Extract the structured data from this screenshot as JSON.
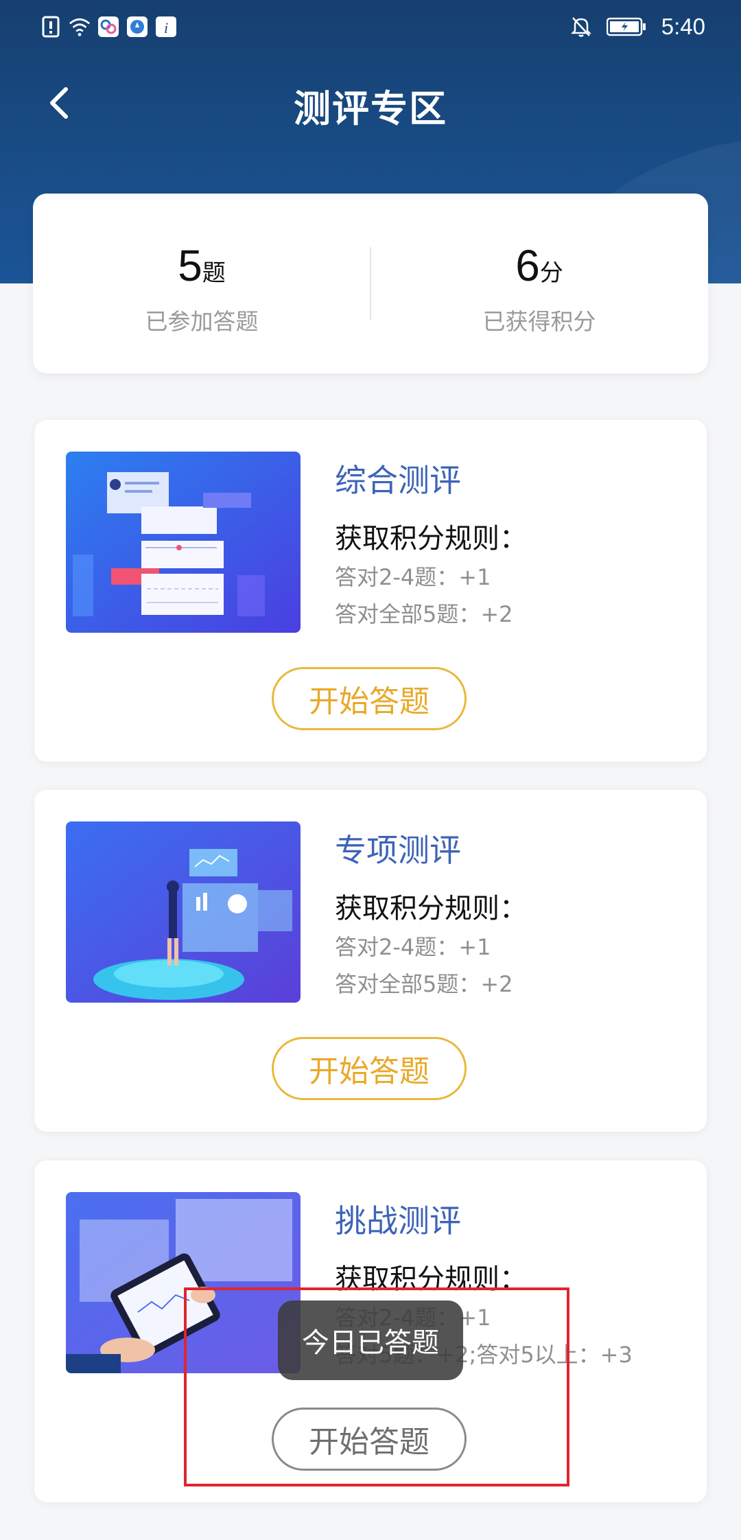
{
  "status": {
    "time": "5:40"
  },
  "header": {
    "title": "测评专区"
  },
  "stats": {
    "answered_count": "5",
    "answered_unit": "题",
    "answered_label": "已参加答题",
    "points": "6",
    "points_unit": "分",
    "points_label": "已获得积分"
  },
  "cards": [
    {
      "title": "综合测评",
      "rule_title": "获取积分规则：",
      "rules": [
        "答对2-4题：+1",
        "答对全部5题：+2"
      ],
      "button": "开始答题"
    },
    {
      "title": "专项测评",
      "rule_title": "获取积分规则：",
      "rules": [
        "答对2-4题：+1",
        "答对全部5题：+2"
      ],
      "button": "开始答题"
    },
    {
      "title": "挑战测评",
      "rule_title": "获取积分规则：",
      "rules": [
        "答对2-4题：+1",
        "答对5题：+2;答对5以上：+3"
      ],
      "button": "开始答题"
    }
  ],
  "toast": {
    "text": "今日已答题"
  },
  "colors": {
    "header": "#184a82",
    "accent_blue": "#3d63b8",
    "button_gold": "#e8b93a",
    "highlight_red": "#e0262e"
  }
}
